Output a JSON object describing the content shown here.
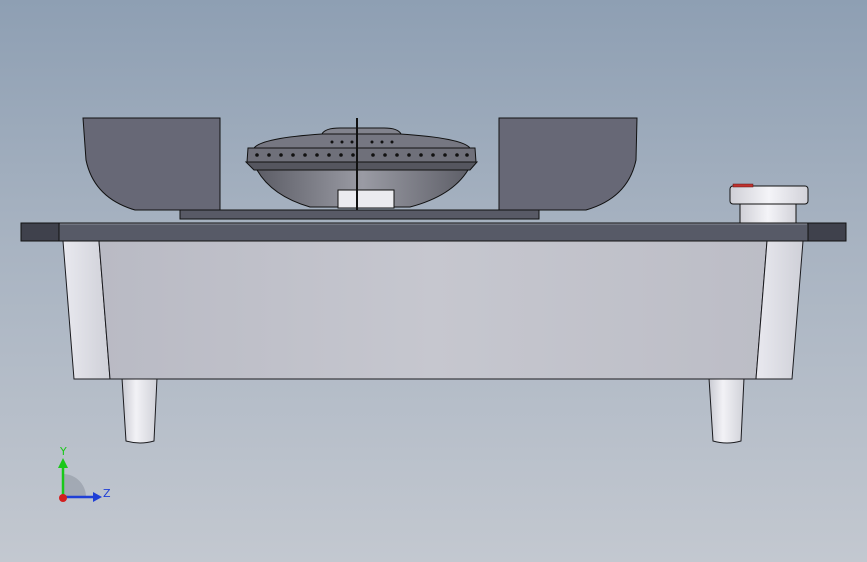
{
  "viewport": {
    "description_free": true
  },
  "triad": {
    "y_label": "Y",
    "z_label": "Z",
    "y_color": "#19c819",
    "z_color": "#1f3fd6",
    "x_color": "#d21e1e"
  },
  "colors": {
    "background_top": "#8e9fb3",
    "background_bottom": "#c3c8d0",
    "body_front": "#c4c4cc",
    "body_side": "#d8d8e0",
    "top_panel": "#5b5e6b",
    "pan_support": "#6a6b78",
    "burner": "#7a7b84",
    "knob": "#e6e6ec",
    "knob_indicator": "#c0322e"
  }
}
